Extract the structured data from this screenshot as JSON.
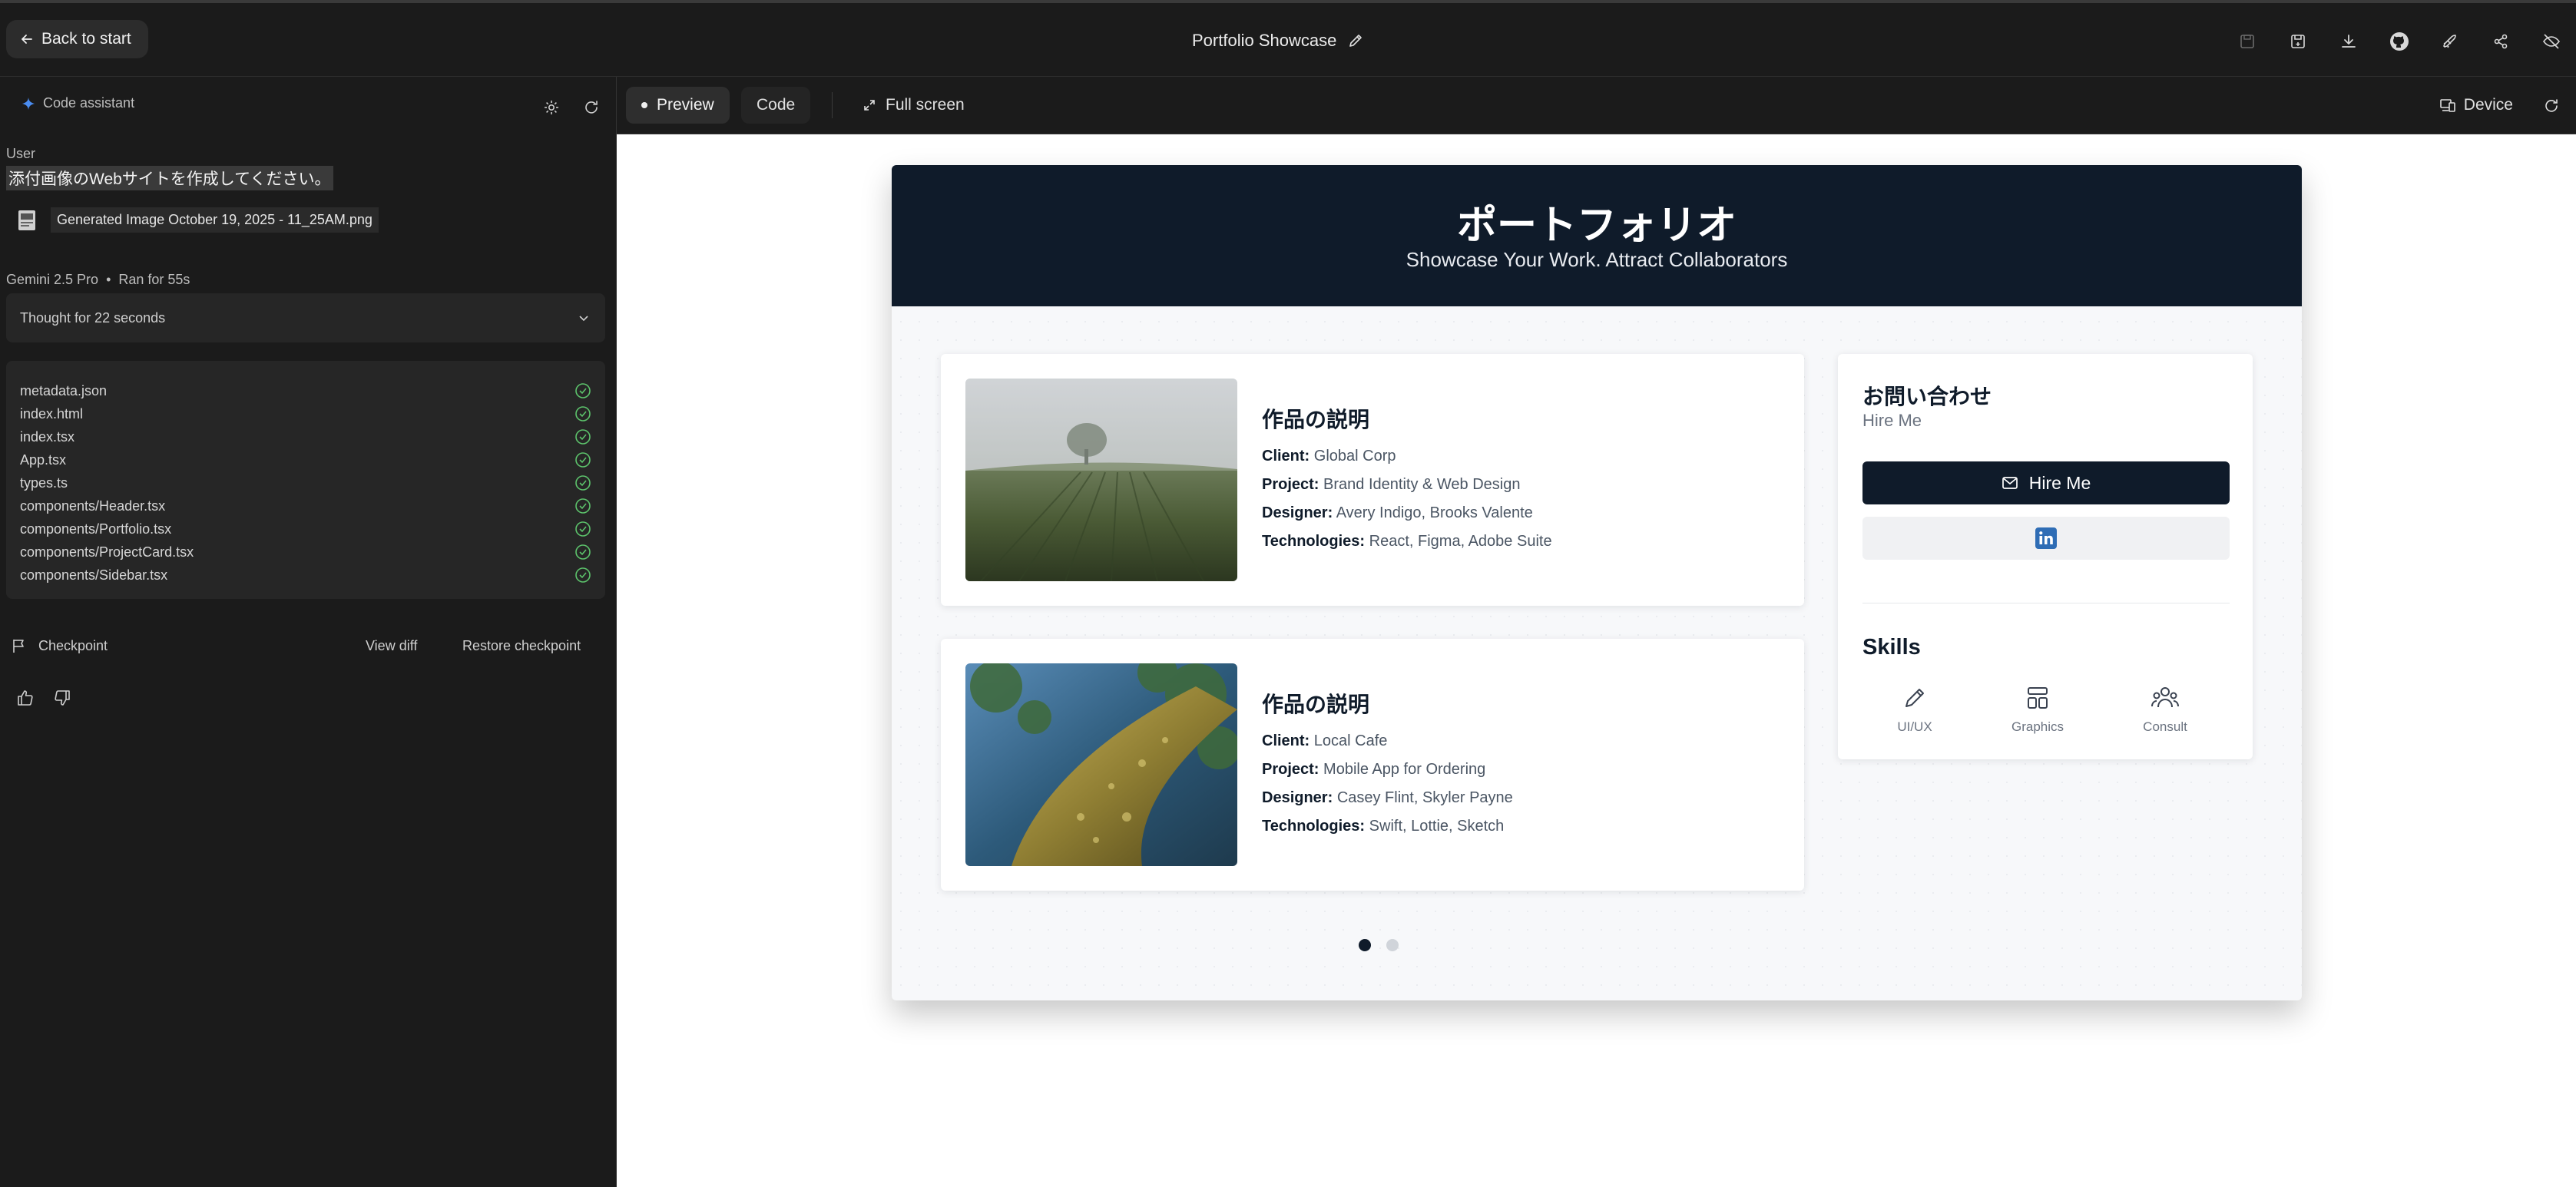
{
  "topbar": {
    "back_label": "Back to start",
    "title": "Portfolio Showcase",
    "icons": [
      "save-icon",
      "save-copy-icon",
      "download-icon",
      "github-icon",
      "deploy-rocket-icon",
      "share-icon",
      "hide-icon"
    ]
  },
  "assistant": {
    "label": "Code assistant",
    "user_label": "User",
    "user_message": "添付画像のWebサイトを作成してください。",
    "attachment_name": "Generated Image October 19, 2025 - 11_25AM.png",
    "model": "Gemini 2.5 Pro",
    "ran_for": "Ran for 55s",
    "thought": "Thought for 22 seconds",
    "files": [
      "metadata.json",
      "index.html",
      "index.tsx",
      "App.tsx",
      "types.ts",
      "components/Header.tsx",
      "components/Portfolio.tsx",
      "components/ProjectCard.tsx",
      "components/Sidebar.tsx"
    ],
    "checkpoint_label": "Checkpoint",
    "view_diff": "View diff",
    "restore": "Restore checkpoint"
  },
  "preview_toolbar": {
    "preview": "Preview",
    "code": "Code",
    "full_screen": "Full screen",
    "device": "Device"
  },
  "site": {
    "title": "ポートフォリオ",
    "subtitle": "Showcase Your Work. Attract Collaborators",
    "labels": {
      "client": "Client:",
      "project": "Project:",
      "designer": "Designer:",
      "technologies": "Technologies:"
    },
    "projects": [
      {
        "title": "作品の説明",
        "client": "Global Corp",
        "project": "Brand Identity & Web Design",
        "designer": "Avery Indigo, Brooks Valente",
        "technologies": "React, Figma, Adobe Suite"
      },
      {
        "title": "作品の説明",
        "client": "Local Cafe",
        "project": "Mobile App for Ordering",
        "designer": "Casey Flint, Skyler Payne",
        "technologies": "Swift, Lottie, Sketch"
      }
    ],
    "contact": {
      "title": "お問い合わせ",
      "subtitle": "Hire Me",
      "button": "Hire Me"
    },
    "skills": {
      "title": "Skills",
      "items": [
        "UI/UX",
        "Graphics",
        "Consult"
      ]
    },
    "carousel": {
      "active_index": 0,
      "count": 2
    }
  },
  "colors": {
    "header_bg": "#0f1b2a",
    "accent_blue": "#4a8cf0",
    "check_green": "#5cc26b",
    "linkedin": "#2f6db5"
  }
}
